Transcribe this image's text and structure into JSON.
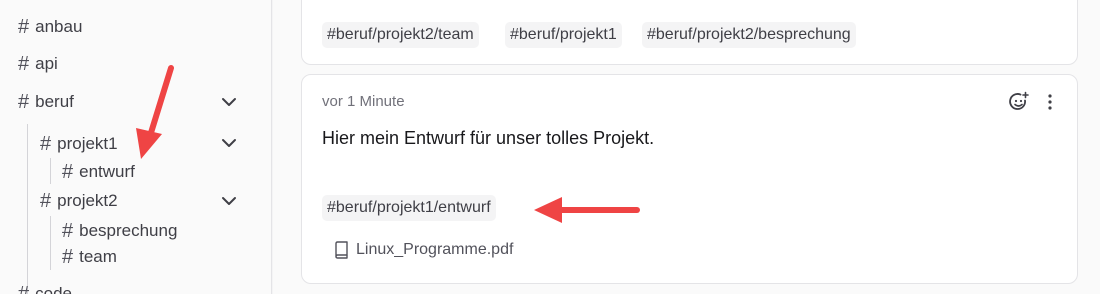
{
  "sidebar": {
    "tags": {
      "anbau": "anbau",
      "api": "api",
      "beruf": "beruf",
      "projekt1": "projekt1",
      "entwurf": "entwurf",
      "projekt2": "projekt2",
      "besprechung": "besprechung",
      "team": "team",
      "code": "code"
    },
    "hash_symbol": "#"
  },
  "top_card": {
    "tags": [
      "#beruf/projekt2/team",
      "#beruf/projekt1",
      "#beruf/projekt2/besprechung"
    ]
  },
  "memo": {
    "time": "vor 1 Minute",
    "text": "Hier mein Entwurf für unser tolles Projekt.",
    "tag": "#beruf/projekt1/entwurf",
    "attachment": "Linux_Programme.pdf",
    "reaction_icon": "emoji-add-icon",
    "more_icon": "more-vertical-icon"
  },
  "colors": {
    "annotation_arrow": "#ef4444",
    "sidebar_bg": "#fafafa",
    "chip_bg": "#f4f4f5"
  }
}
